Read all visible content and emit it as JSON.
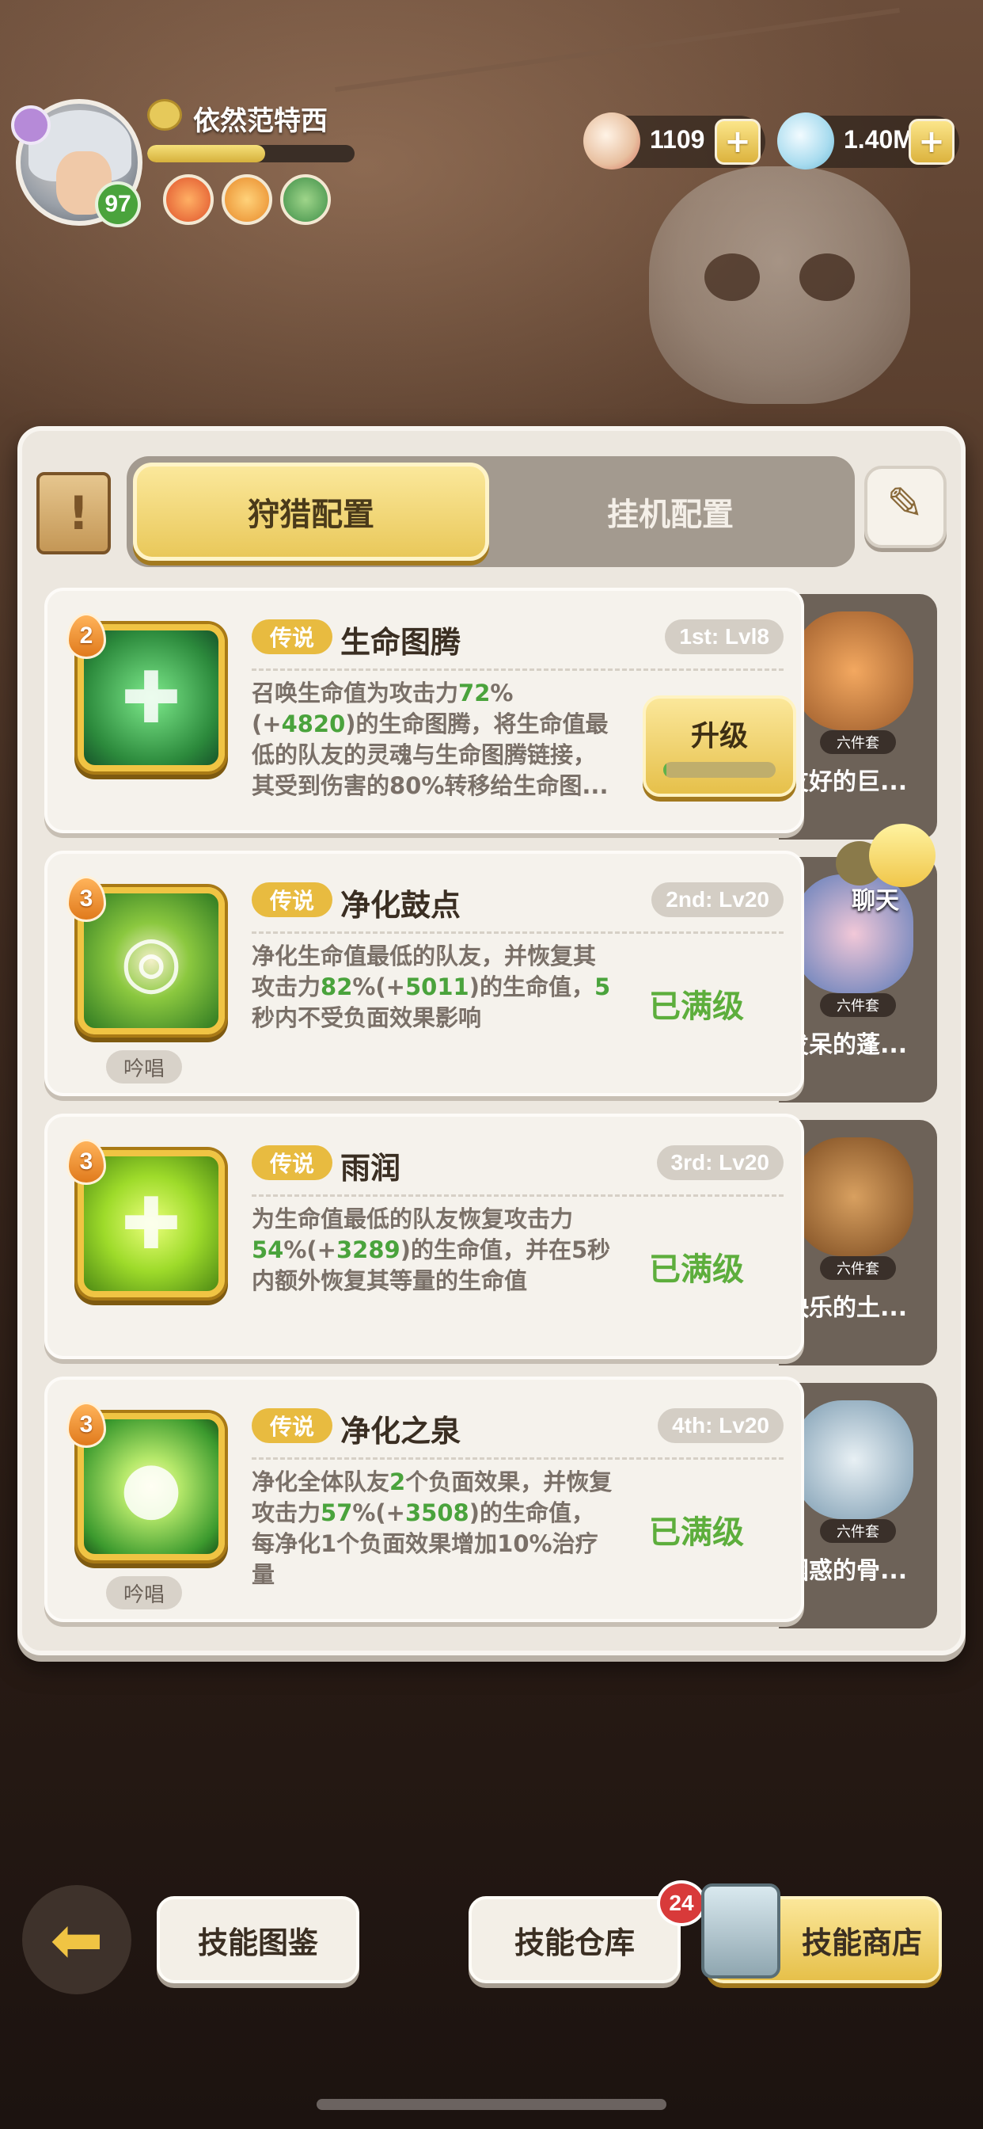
{
  "player": {
    "name": "依然范特西",
    "level": "97",
    "exp_fraction": 0.57
  },
  "currencies": [
    {
      "icon": "shell-icon",
      "value": "1109"
    },
    {
      "icon": "crystal-icon",
      "value": "1.40M"
    }
  ],
  "tabs": {
    "hunt": "狩猎配置",
    "idle": "挂机配置",
    "active": "hunt"
  },
  "skills": [
    {
      "level": "2",
      "rarity": "传说",
      "name": "生命图腾",
      "slot": "1st: Lvl8",
      "desc_parts": [
        "召唤生命值为攻击力",
        "72",
        "%(+",
        "4820",
        ")的生命图腾，将生命值最低的队友的灵魂与生命图腾链接，其受到伤害的80%转移给生命图..."
      ],
      "status": "upgrade",
      "upgrade_label": "升级",
      "upgrade_progress": 0.03,
      "chant": "",
      "companion": {
        "tag": "六件套",
        "name": "友好的巨..."
      }
    },
    {
      "level": "3",
      "rarity": "传说",
      "name": "净化鼓点",
      "slot": "2nd: Lv20",
      "desc_parts": [
        "净化生命值最低的队友，并恢复其攻击力",
        "82",
        "%(+",
        "5011",
        ")的生命值，",
        "5",
        "秒内不受负面效果影响"
      ],
      "status": "maxed",
      "maxed_label": "已满级",
      "chant": "吟唱",
      "companion": {
        "tag": "六件套",
        "name": "发呆的蓬..."
      }
    },
    {
      "level": "3",
      "rarity": "传说",
      "name": "雨润",
      "slot": "3rd: Lv20",
      "desc_parts": [
        "为生命值最低的队友恢复攻击力",
        "54",
        "%(+",
        "3289",
        ")的生命值，并在5秒内额外恢复其等量的生命值"
      ],
      "status": "maxed",
      "maxed_label": "已满级",
      "chant": "",
      "companion": {
        "tag": "六件套",
        "name": "快乐的土..."
      }
    },
    {
      "level": "3",
      "rarity": "传说",
      "name": "净化之泉",
      "slot": "4th: Lv20",
      "desc_parts": [
        "净化全体队友",
        "2",
        "个负面效果，并恢复攻击力",
        "57",
        "%(+",
        "3508",
        ")的生命值，每净化1个负面效果增加10%治疗量"
      ],
      "status": "maxed",
      "maxed_label": "已满级",
      "chant": "吟唱",
      "companion": {
        "tag": "六件套",
        "name": "困惑的骨..."
      }
    }
  ],
  "chat": {
    "label": "聊天"
  },
  "bottom": {
    "codex": "技能图鉴",
    "warehouse": "技能仓库",
    "warehouse_badge": "24",
    "shop": "技能商店"
  },
  "colors": {
    "accent_gold": "#e8bb40",
    "highlight_green": "#4aa33c",
    "maxed_green": "#5dae3c",
    "badge_red": "#d83a3a"
  }
}
